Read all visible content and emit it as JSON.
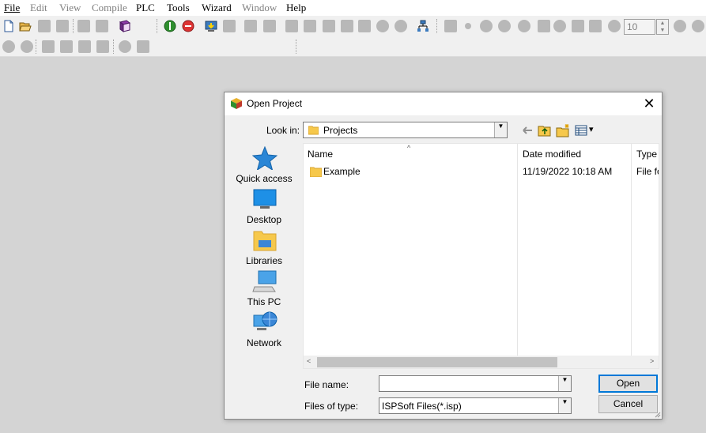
{
  "menu": {
    "items": [
      {
        "key": "file",
        "label": "File",
        "enabled": true
      },
      {
        "key": "edit",
        "label": "Edit",
        "enabled": false
      },
      {
        "key": "view",
        "label": "View",
        "enabled": false
      },
      {
        "key": "compile",
        "label": "Compile",
        "enabled": false
      },
      {
        "key": "plc",
        "label": "PLC",
        "enabled": true
      },
      {
        "key": "tools",
        "label": "Tools",
        "enabled": true
      },
      {
        "key": "wizard",
        "label": "Wizard",
        "enabled": true
      },
      {
        "key": "window",
        "label": "Window",
        "enabled": false
      },
      {
        "key": "help",
        "label": "Help",
        "enabled": true
      }
    ]
  },
  "toolbar": {
    "zoom_value": "10",
    "spin_up": "▲",
    "spin_down": "▼"
  },
  "dialog": {
    "title": "Open Project",
    "close_glyph": "✕",
    "look_in_label": "Look in:",
    "look_in_value": "Projects",
    "combo_arrow": "▼",
    "view_menu_arrow": "▾",
    "places": [
      {
        "key": "quick-access",
        "label": "Quick access",
        "icon": "star-icon"
      },
      {
        "key": "desktop",
        "label": "Desktop",
        "icon": "desktop-icon"
      },
      {
        "key": "libraries",
        "label": "Libraries",
        "icon": "libraries-icon"
      },
      {
        "key": "this-pc",
        "label": "This PC",
        "icon": "computer-icon"
      },
      {
        "key": "network",
        "label": "Network",
        "icon": "network-icon"
      }
    ],
    "columns": {
      "name": "Name",
      "date_modified": "Date modified",
      "type": "Type",
      "sort_glyph": "^"
    },
    "files": [
      {
        "name": "Example",
        "date_modified": "11/19/2022 10:18 AM",
        "type": "File fo"
      }
    ],
    "scroll_left": "<",
    "scroll_right": ">",
    "file_name_label": "File name:",
    "file_name_value": "",
    "files_of_type_label": "Files of type:",
    "files_of_type_value": "ISPSoft Files(*.isp)",
    "open_button": "Open",
    "cancel_button": "Cancel"
  },
  "colors": {
    "accent": "#0078d7",
    "folder": "#f6c84b",
    "workspace": "#d4d4d4"
  }
}
